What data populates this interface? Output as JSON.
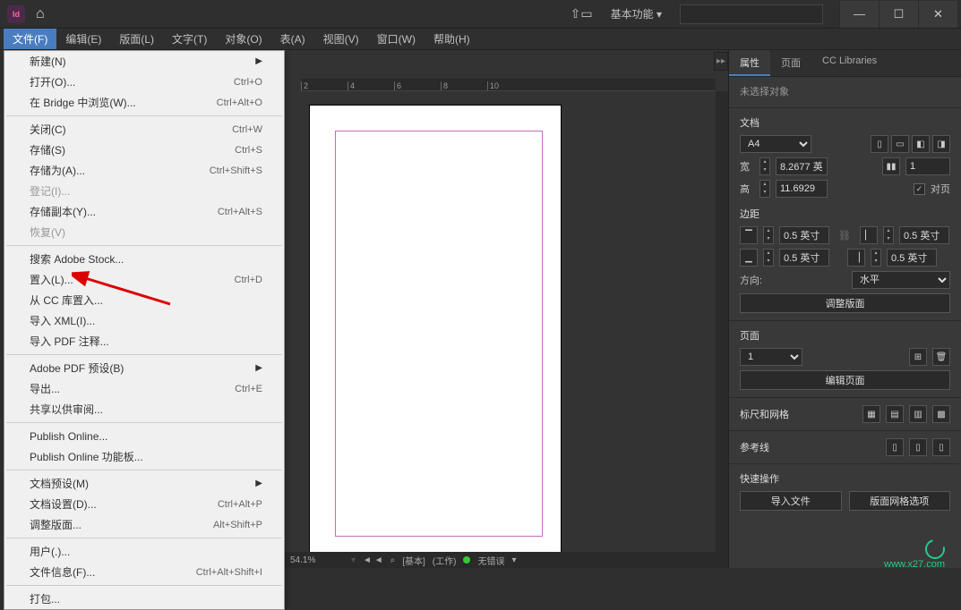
{
  "app": {
    "id_badge": "Id"
  },
  "titlebar": {
    "workspace": "基本功能",
    "search_placeholder": ""
  },
  "menubar": {
    "file": "文件(F)",
    "edit": "编辑(E)",
    "layout": "版面(L)",
    "type": "文字(T)",
    "object": "对象(O)",
    "table": "表(A)",
    "view": "视图(V)",
    "window": "窗口(W)",
    "help": "帮助(H)"
  },
  "file_menu": {
    "new": "新建(N)",
    "open": "打开(O)...",
    "open_sc": "Ctrl+O",
    "browse_bridge": "在 Bridge 中浏览(W)...",
    "browse_bridge_sc": "Ctrl+Alt+O",
    "close": "关闭(C)",
    "close_sc": "Ctrl+W",
    "save": "存储(S)",
    "save_sc": "Ctrl+S",
    "save_as": "存储为(A)...",
    "save_as_sc": "Ctrl+Shift+S",
    "checkin": "登记(I)...",
    "save_copy": "存储副本(Y)...",
    "save_copy_sc": "Ctrl+Alt+S",
    "revert": "恢复(V)",
    "search_stock": "搜索 Adobe Stock...",
    "place": "置入(L)...",
    "place_sc": "Ctrl+D",
    "place_cc": "从 CC 库置入...",
    "import_xml": "导入 XML(I)...",
    "import_pdf_comments": "导入 PDF 注释...",
    "pdf_presets": "Adobe PDF 预设(B)",
    "export": "导出...",
    "export_sc": "Ctrl+E",
    "share_review": "共享以供审阅...",
    "publish_online": "Publish Online...",
    "publish_dashboard": "Publish Online 功能板...",
    "doc_presets": "文档预设(M)",
    "doc_setup": "文档设置(D)...",
    "doc_setup_sc": "Ctrl+Alt+P",
    "adjust_layout": "调整版面...",
    "adjust_layout_sc": "Alt+Shift+P",
    "user": "用户(.)...",
    "file_info": "文件信息(F)...",
    "file_info_sc": "Ctrl+Alt+Shift+I",
    "package": "打包..."
  },
  "ruler": {
    "t2": "2",
    "t4": "4",
    "t6": "6",
    "t8": "8",
    "t10": "10"
  },
  "status": {
    "zoom": "54.1%",
    "arrows": "◄ ◄",
    "search_icon": "⌕",
    "mode_basic": "[基本]",
    "mode_work": "(工作)",
    "errors": "无错误"
  },
  "panel": {
    "tabs": {
      "props": "属性",
      "pages": "页面",
      "cc": "CC Libraries"
    },
    "no_selection": "未选择对象",
    "doc_section": "文档",
    "page_size": "A4",
    "w_label": "宽",
    "w_val": "8.2677 英",
    "h_label": "高",
    "h_val": "11.6929",
    "units_label": "1",
    "facing_label": "对页",
    "margins_section": "边距",
    "m_top": "0.5 英寸",
    "m_bottom": "0.5 英寸",
    "m_left": "0.5 英寸",
    "m_right": "0.5 英寸",
    "orientation_label": "方向:",
    "orientation_val": "水平",
    "adjust_layout_btn": "调整版面",
    "pages_section": "页面",
    "page_num": "1",
    "edit_pages_btn": "编辑页面",
    "rulers_section": "标尺和网格",
    "guides_section": "参考线",
    "quick_section": "快速操作",
    "import_file_btn": "导入文件",
    "layout_grid_btn": "版面网格选项"
  },
  "watermark": {
    "site": "www.x27.com"
  }
}
